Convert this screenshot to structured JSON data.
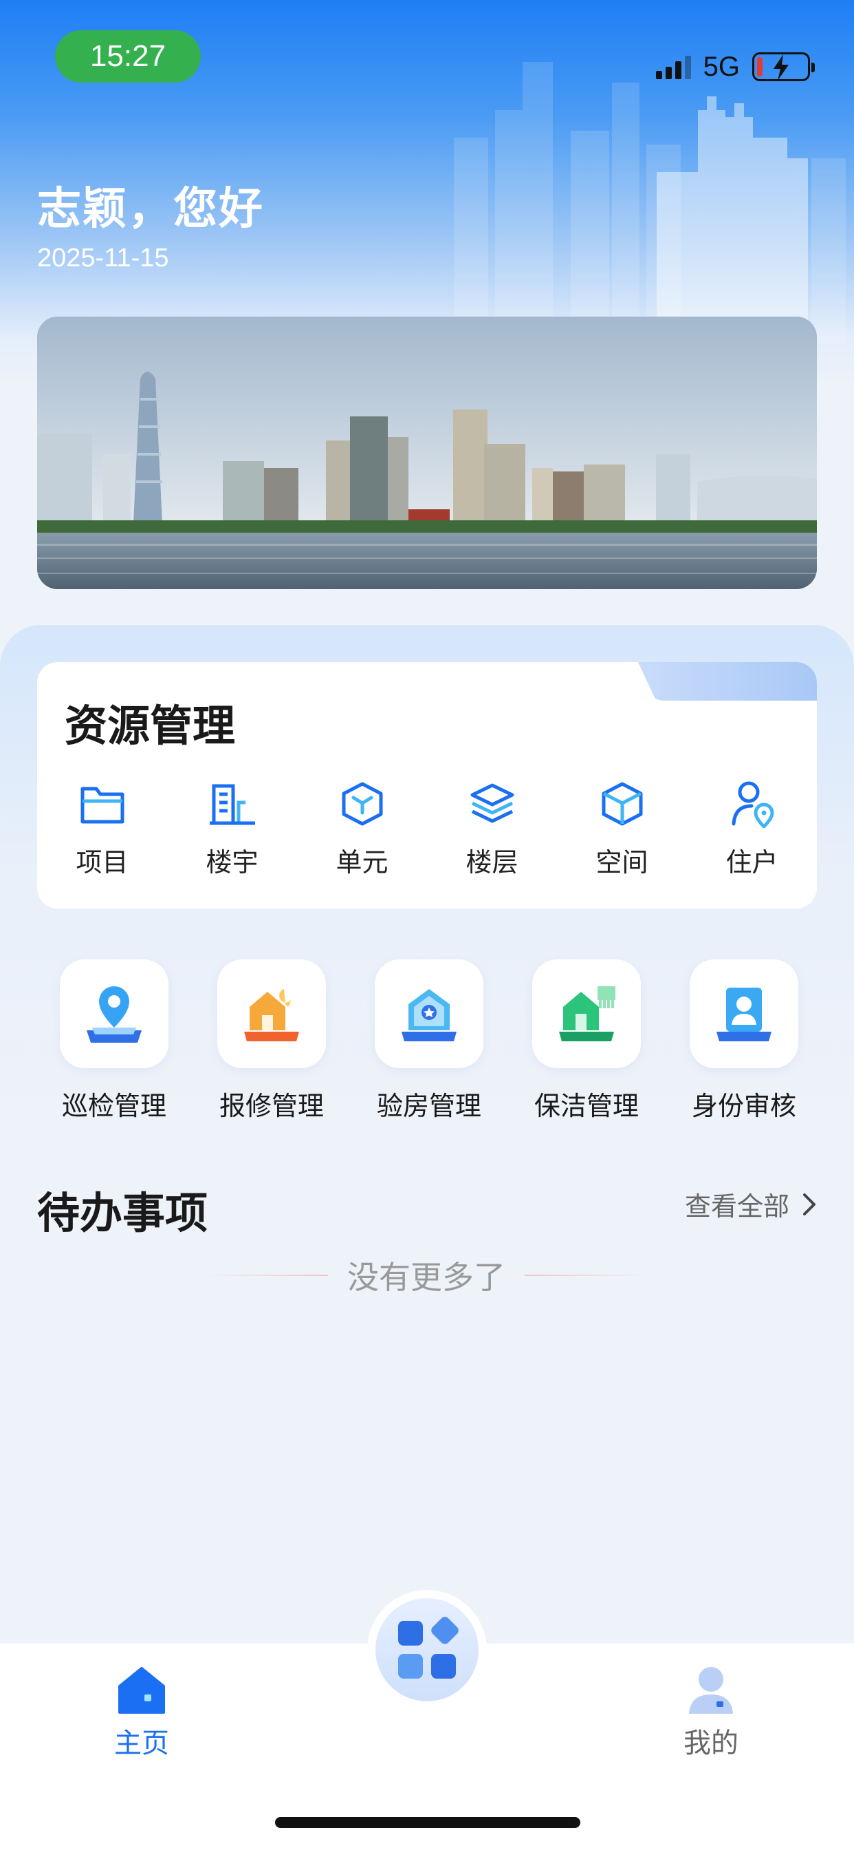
{
  "status_bar": {
    "time": "15:27",
    "network": "5G",
    "battery_level": 0.12
  },
  "header": {
    "greeting": "志颖，您好",
    "date": "2025-11-15"
  },
  "resource_management": {
    "title": "资源管理",
    "items": [
      {
        "label": "项目",
        "icon": "folder-icon"
      },
      {
        "label": "楼宇",
        "icon": "building-icon"
      },
      {
        "label": "单元",
        "icon": "cube-unit-icon"
      },
      {
        "label": "楼层",
        "icon": "layers-icon"
      },
      {
        "label": "空间",
        "icon": "box-space-icon"
      },
      {
        "label": "住户",
        "icon": "resident-location-icon"
      }
    ]
  },
  "quick_apps": [
    {
      "label": "巡检管理",
      "icon": "location-pin-icon"
    },
    {
      "label": "报修管理",
      "icon": "house-repair-icon"
    },
    {
      "label": "验房管理",
      "icon": "house-star-icon"
    },
    {
      "label": "保洁管理",
      "icon": "house-cleaning-icon"
    },
    {
      "label": "身份审核",
      "icon": "id-card-icon"
    }
  ],
  "todo": {
    "title": "待办事项",
    "view_all": "查看全部",
    "empty_text": "没有更多了"
  },
  "tab_bar": {
    "home": "主页",
    "mine": "我的",
    "center_icon": "apps-grid-icon"
  },
  "colors": {
    "accent": "#1b6ff3",
    "time_pill": "#34b04e",
    "battery_low": "#e53935"
  }
}
